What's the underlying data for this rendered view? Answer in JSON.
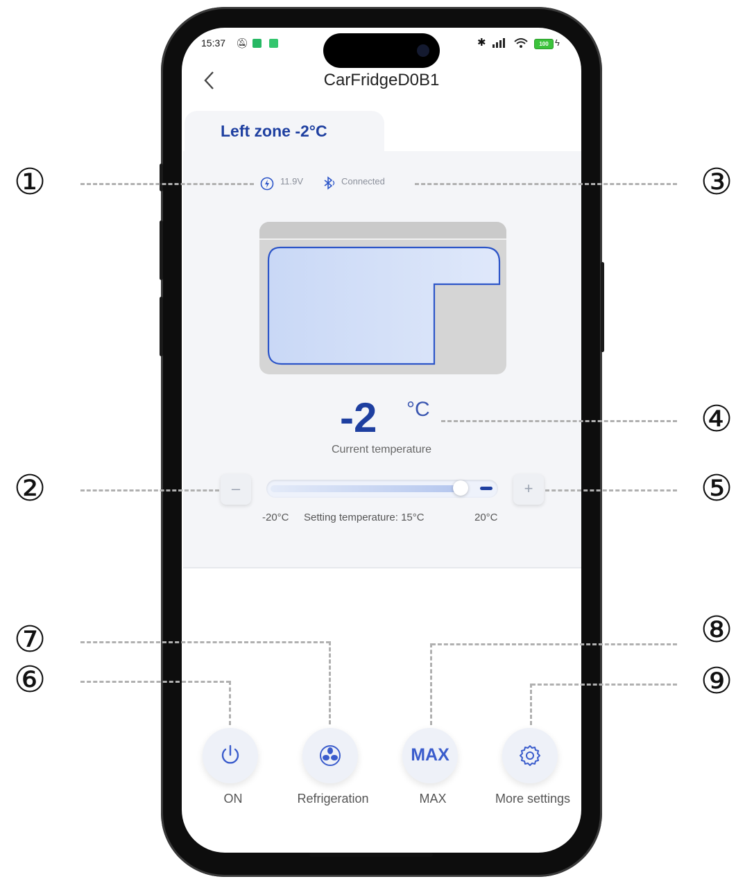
{
  "status_bar": {
    "time": "15:37",
    "battery": "100"
  },
  "header": {
    "back_icon": "chevron-left-icon",
    "title": "CarFridgeD0B1"
  },
  "zone_tab": {
    "label": "Left zone -2°C"
  },
  "device_status": {
    "voltage": "11.9V",
    "connection": "Connected"
  },
  "temperature": {
    "value": "-2",
    "unit": "°C",
    "label": "Current temperature"
  },
  "setting": {
    "min_label": "-20°C",
    "setting_text": "Setting temperature: 15°C",
    "max_label": "20°C",
    "slider_fraction": 0.875
  },
  "controls": [
    {
      "label": "ON",
      "icon": "power-icon"
    },
    {
      "label": "Refrigeration",
      "icon": "fan-icon"
    },
    {
      "label": "MAX",
      "icon_text": "MAX"
    },
    {
      "label": "More settings",
      "icon": "gear-icon"
    }
  ],
  "callouts": [
    "①",
    "②",
    "③",
    "④",
    "⑤",
    "⑥",
    "⑦",
    "⑧",
    "⑨"
  ],
  "colors": {
    "accent": "#1e3fa0",
    "panel": "#f4f5f8",
    "dash": "#b0b0b0"
  }
}
